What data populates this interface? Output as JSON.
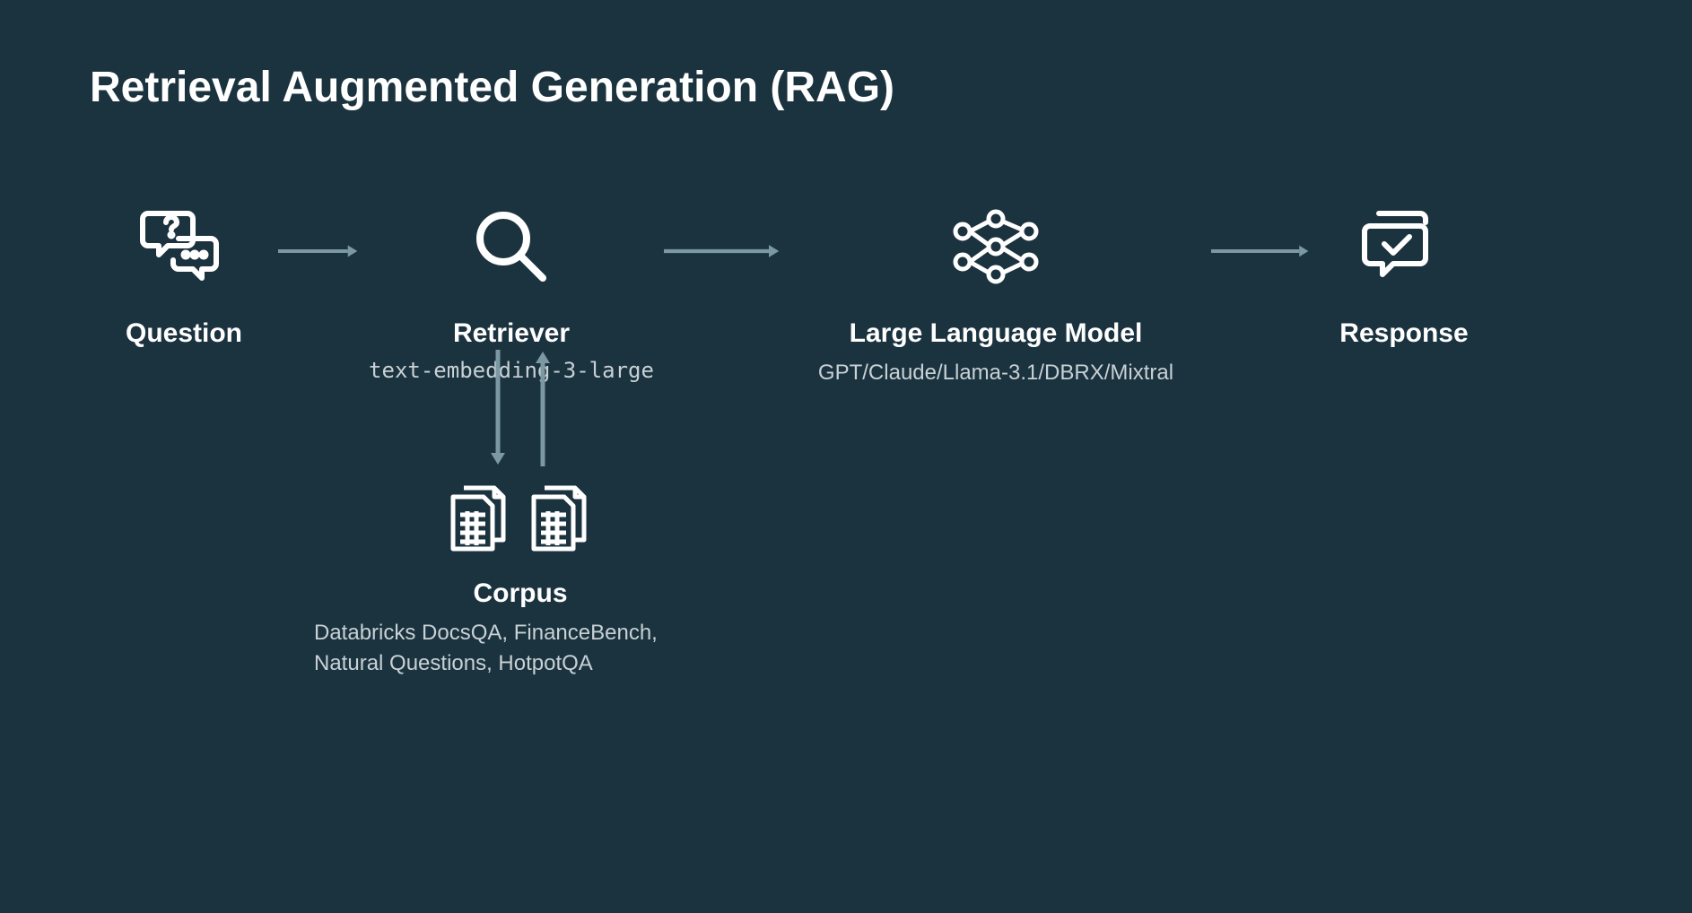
{
  "title": "Retrieval Augmented Generation (RAG)",
  "nodes": {
    "question": {
      "label": "Question"
    },
    "retriever": {
      "label": "Retriever",
      "sub": "text-embedding-3-large"
    },
    "llm": {
      "label": "Large Language Model",
      "sub": "GPT/Claude/Llama-3.1/DBRX/Mixtral"
    },
    "response": {
      "label": "Response"
    },
    "corpus": {
      "label": "Corpus",
      "sub": "Databricks DocsQA, FinanceBench, Natural Questions, HotpotQA"
    }
  }
}
